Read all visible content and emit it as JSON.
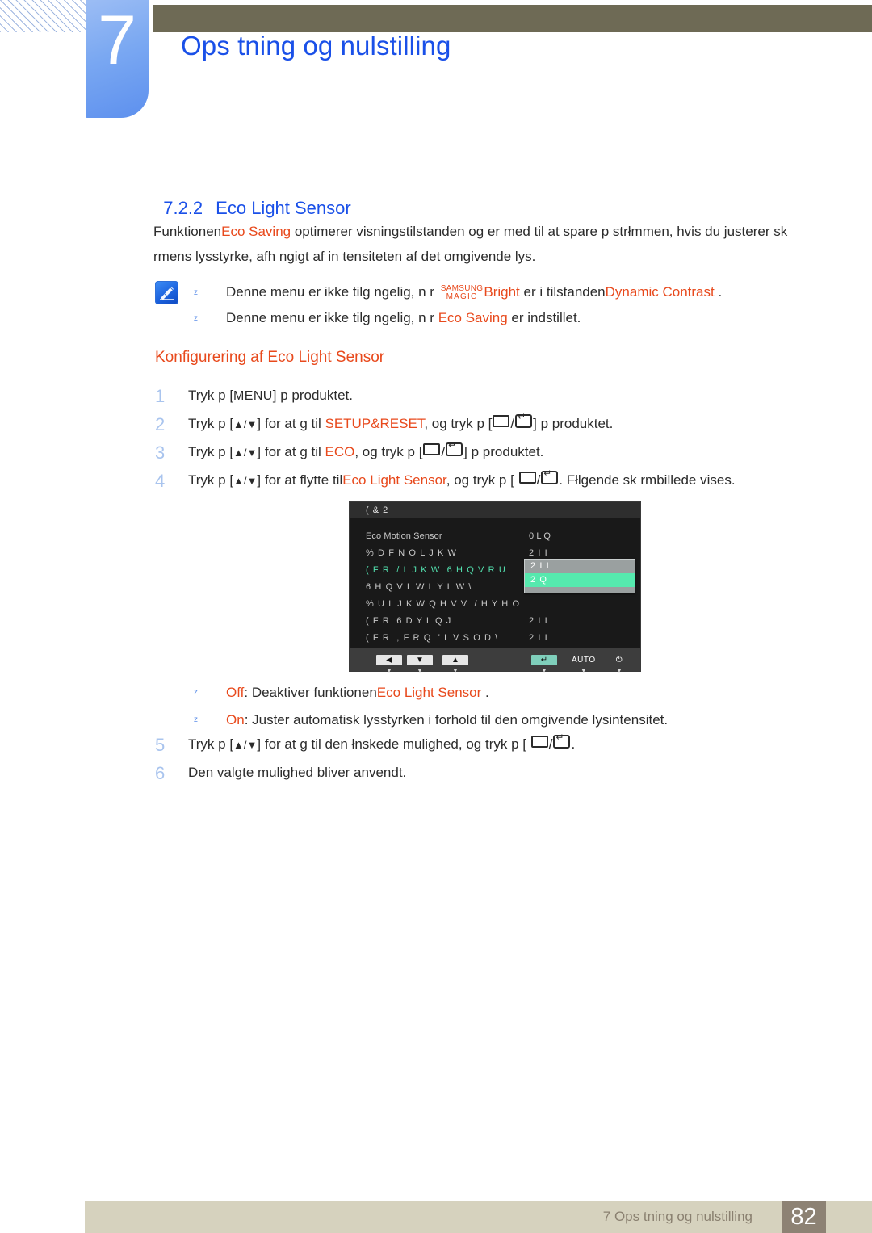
{
  "header": {
    "chapter_number": "7",
    "chapter_title": "Ops tning og nulstilling",
    "topbar_color": "#6e6a55",
    "chapter_block_color": "#7aa8f2",
    "title_color": "#1a50e8"
  },
  "section": {
    "number": "7.2.2",
    "title": "Eco Light Sensor",
    "intro_a": "Funktionen",
    "intro_keyword": "Eco Saving",
    "intro_b": " optimerer visningstilstanden og er med til at spare p  strłmmen, hvis du justerer sk rmens lysstyrke, afh ngigt af in  tensiteten af det omgivende lys."
  },
  "note": {
    "icon": "note-pen-icon",
    "bullet_glyph": "z",
    "items": [
      {
        "pre": "Denne menu er ikke tilg ngelig, n r ",
        "magic_top": "SAMSUNG",
        "magic_bottom": "MAGIC",
        "kw1": "Bright",
        "mid": " er i tilstanden",
        "kw2": "Dynamic Contrast",
        "post": " ."
      },
      {
        "pre": "Denne menu er ikke tilg ngelig, n r  ",
        "kw1": "Eco Saving",
        "post": " er indstillet."
      }
    ]
  },
  "procedure": {
    "heading": "Konfigurering af Eco Light Sensor",
    "steps": [
      {
        "num": "1",
        "parts": [
          {
            "t": "Tryk p  [",
            "k": false
          },
          {
            "t": "MENU",
            "k": "cap"
          },
          {
            "t": "] p  produktet.",
            "k": false
          }
        ]
      },
      {
        "num": "2",
        "parts": [
          {
            "t": "Tryk p  [",
            "k": false
          },
          {
            "t": "▲/▼",
            "k": "glyph"
          },
          {
            "t": "] for at g  til ",
            "k": false
          },
          {
            "t": "SETUP&RESET",
            "k": "kw"
          },
          {
            "t": ", og tryk p  [",
            "k": false
          },
          {
            "t": "rect-enter",
            "k": "btn"
          },
          {
            "t": "] p  produktet.",
            "k": false
          }
        ]
      },
      {
        "num": "3",
        "parts": [
          {
            "t": "Tryk p  [",
            "k": false
          },
          {
            "t": "▲/▼",
            "k": "glyph"
          },
          {
            "t": "] for at g  til ",
            "k": false
          },
          {
            "t": "ECO",
            "k": "kw"
          },
          {
            "t": ", og tryk p  [",
            "k": false
          },
          {
            "t": "rect-enter",
            "k": "btn"
          },
          {
            "t": "] p  produktet.",
            "k": false
          }
        ]
      },
      {
        "num": "4",
        "parts": [
          {
            "t": "Tryk p  [",
            "k": false
          },
          {
            "t": "▲/▼",
            "k": "glyph"
          },
          {
            "t": "] for at flytte til",
            "k": false
          },
          {
            "t": "Eco Light Sensor",
            "k": "kw"
          },
          {
            "t": ", og tryk p  [ ",
            "k": false
          },
          {
            "t": "rect-enter",
            "k": "btn"
          },
          {
            "t": ". Fłlgende sk rmbillede vises.",
            "k": false
          }
        ]
      }
    ],
    "steps_bottom": [
      {
        "num": "5",
        "parts": [
          {
            "t": "Tryk p  [",
            "k": false
          },
          {
            "t": "▲/▼",
            "k": "glyph"
          },
          {
            "t": "] for at g  til den łnskede mulighed, og tryk p  [ ",
            "k": false
          },
          {
            "t": "rect-enter",
            "k": "btn"
          },
          {
            "t": ".",
            "k": false
          }
        ]
      },
      {
        "num": "6",
        "parts": [
          {
            "t": "Den valgte mulighed bliver anvendt.",
            "k": false
          }
        ]
      }
    ]
  },
  "osd": {
    "title": "( & 2",
    "rows": [
      {
        "label": "Eco Motion Sensor",
        "value": "0 L Q",
        "state": "plain"
      },
      {
        "label": "% D F N O L J K W",
        "value": "2 I I",
        "state": "normal"
      },
      {
        "label": "( F R  / L J K W  6 H Q V R U",
        "value": "",
        "state": "selected"
      },
      {
        "label": "6 H Q V L W L Y L W \\",
        "value": "",
        "state": "normal"
      },
      {
        "label": "% U L J K W Q H V V  / H Y H O",
        "value": "",
        "state": "normal"
      },
      {
        "label": "( F R  6 D Y L Q J",
        "value": "2 I I",
        "state": "normal"
      },
      {
        "label": "( F R  , F R Q  ' L V S O D \\",
        "value": "2 I I",
        "state": "normal"
      }
    ],
    "dropdown": {
      "options": [
        {
          "text": "2 I I",
          "selected": false
        },
        {
          "text": "2 Q",
          "selected": true
        }
      ],
      "highlight_color": "#56e9ae",
      "background_color": "#9aa0a0"
    },
    "footer_buttons": [
      {
        "glyph": "◀",
        "kind": "cap",
        "tick": "▼"
      },
      {
        "glyph": "▼",
        "kind": "cap",
        "tick": "▼"
      },
      {
        "glyph": "▲",
        "kind": "cap",
        "tick": "▼"
      },
      {
        "glyph": "↵",
        "kind": "teal",
        "tick": "▾"
      },
      {
        "glyph": "AUTO",
        "kind": "bare",
        "tick": "▼"
      },
      {
        "glyph": "⏻",
        "kind": "bare",
        "tick": "▼"
      }
    ]
  },
  "osd_notes": [
    {
      "bullet": "z",
      "kw": "Off",
      "mid": ": Deaktiver funktionen",
      "kw2": "Eco Light Sensor",
      "post": " ."
    },
    {
      "bullet": "z",
      "kw": "On",
      "mid": ": Juster automatisk lysstyrken i forhold til den omgivende lysintensitet.",
      "kw2": "",
      "post": ""
    }
  ],
  "footer": {
    "text": "7 Ops tning og nulstilling",
    "page": "82",
    "bar_color": "#d6d2be",
    "page_box_color": "#8d8274"
  }
}
